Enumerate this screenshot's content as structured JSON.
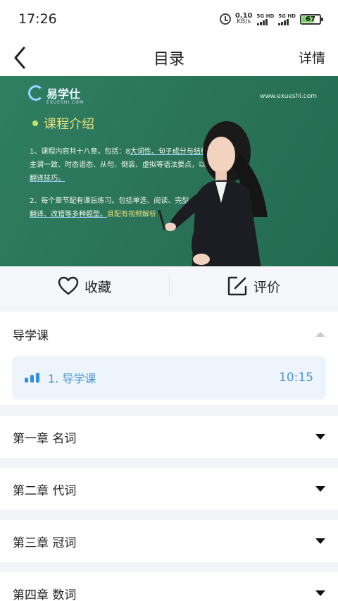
{
  "status": {
    "time": "17:26",
    "net_speed": "0.10",
    "net_unit": "KB/s",
    "sim1": "5G HD",
    "sim2": "5G HD",
    "battery": "67"
  },
  "nav": {
    "title": "目录",
    "detail": "详情"
  },
  "video": {
    "logo": "易学仕",
    "logo_sub": "EXUESHI.COM",
    "url": "www.exueshi.com",
    "heading": "课程介绍",
    "para1_a": "1、课程内容共十八章，包括：8",
    "para1_b": "大词性、句子成分与结构、",
    "para1_c": "主谓一致、时态语态、从句、倒装、虚拟等语法要点，以及",
    "para1_d": "翻译技巧。",
    "para2_a": "2、每个章节配有课后练习。包括单选、",
    "para2_b": "阅读、完型、",
    "para2_c": "翻译、改错等多种题型。",
    "para2_d": "且配有视频解析"
  },
  "actions": {
    "collect": "收藏",
    "review": "评价"
  },
  "sections": [
    {
      "title": "导学课",
      "expanded": true,
      "lessons": [
        {
          "title": "1. 导学课",
          "duration": "10:15"
        }
      ]
    },
    {
      "title": "第一章 名词",
      "expanded": false
    },
    {
      "title": "第二章 代词",
      "expanded": false
    },
    {
      "title": "第三章 冠词",
      "expanded": false
    },
    {
      "title": "第四章 数词",
      "expanded": false
    }
  ],
  "colors": {
    "accent": "#2f8fe8",
    "lesson_bg": "#eef4fb",
    "board_green": "#2a7258"
  }
}
